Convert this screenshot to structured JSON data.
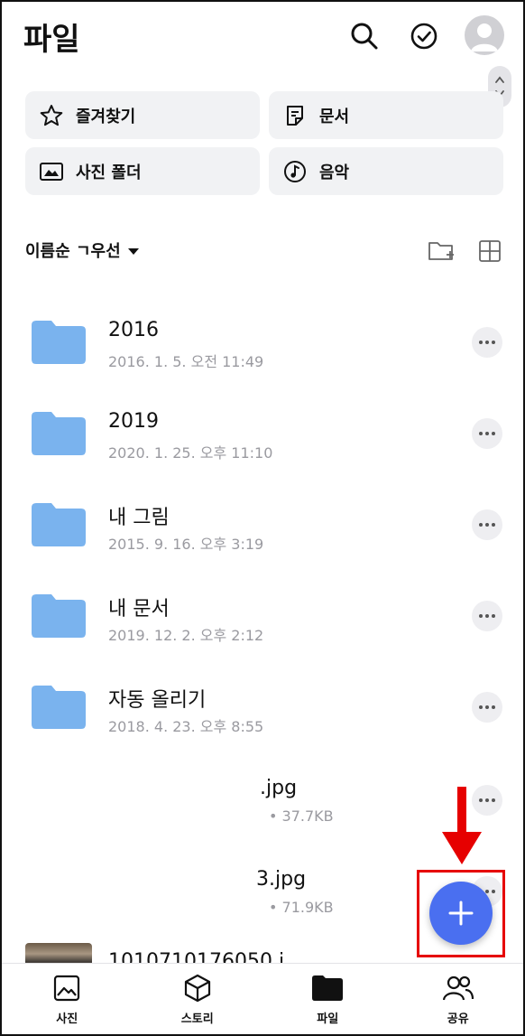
{
  "header": {
    "title": "파일",
    "icons": [
      "search-icon",
      "check-circle-icon",
      "avatar-icon"
    ]
  },
  "quick_tiles": [
    {
      "label": "즐겨찾기",
      "icon": "star-icon"
    },
    {
      "label": "문서",
      "icon": "document-icon"
    },
    {
      "label": "사진 폴더",
      "icon": "photo-folder-icon"
    },
    {
      "label": "음악",
      "icon": "music-icon"
    }
  ],
  "sort": {
    "label": "이름순 ㄱ우선"
  },
  "folders": [
    {
      "name": "2016",
      "date": "2016. 1. 5. 오전 11:49"
    },
    {
      "name": "2019",
      "date": "2020. 1. 25. 오후 11:10"
    },
    {
      "name": "내 그림",
      "date": "2015. 9. 16. 오후 3:19"
    },
    {
      "name": "내 문서",
      "date": "2019. 12. 2. 오후 2:12"
    },
    {
      "name": "자동 올리기",
      "date": "2018. 4. 23. 오후 8:55"
    }
  ],
  "files": [
    {
      "name": ".jpg",
      "size": "• 37.7KB"
    },
    {
      "name": "3.jpg",
      "size": "• 71.9KB"
    }
  ],
  "partial_file_name": "1010710176050.j",
  "bottom_nav": [
    {
      "label": "사진",
      "icon": "photo-icon"
    },
    {
      "label": "스토리",
      "icon": "cube-icon"
    },
    {
      "label": "파일",
      "icon": "folder-icon"
    },
    {
      "label": "공유",
      "icon": "people-icon"
    }
  ],
  "colors": {
    "folder": "#7ab3ee",
    "fab": "#4a6ff0",
    "annotation": "#e60000"
  }
}
